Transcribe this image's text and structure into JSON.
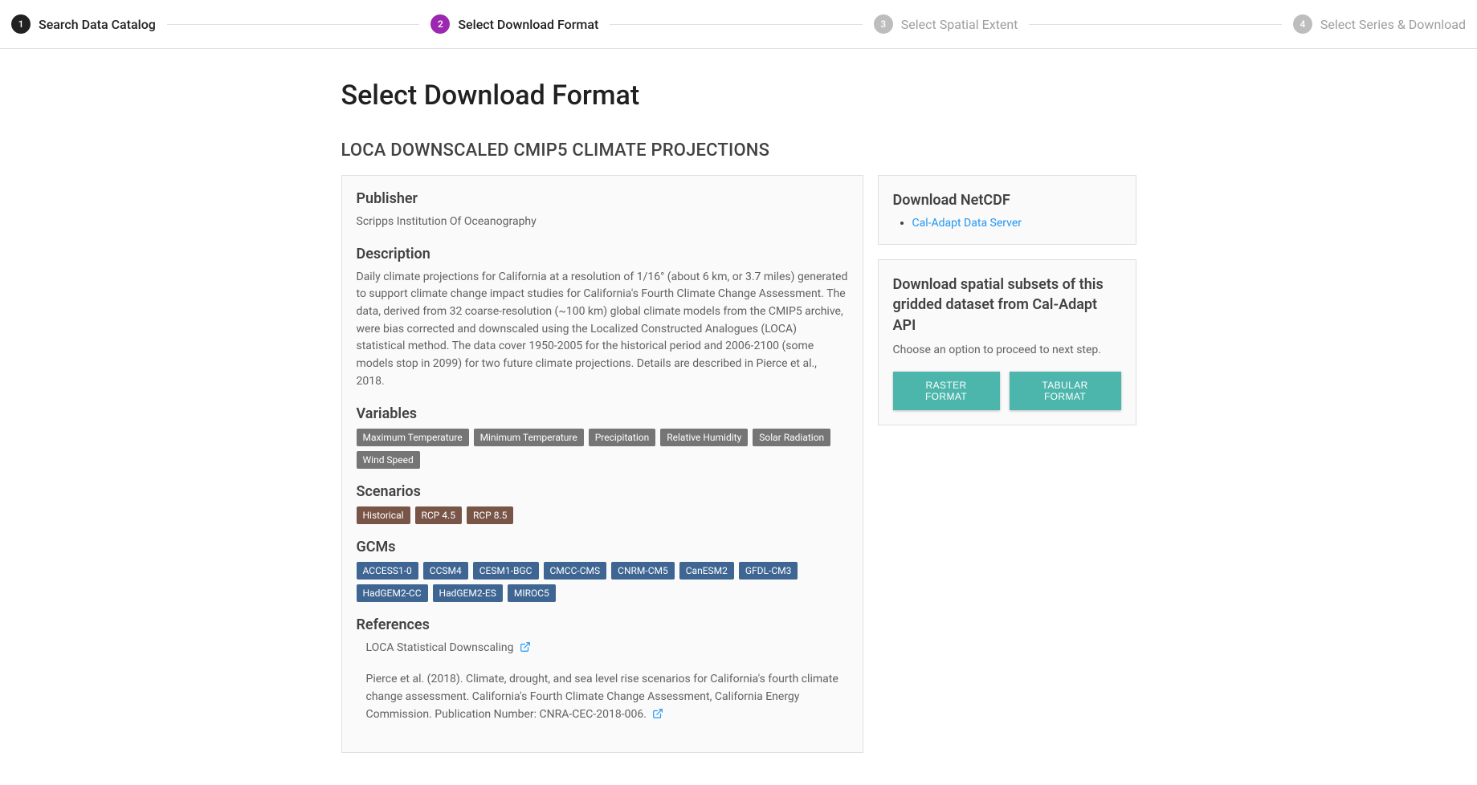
{
  "stepper": {
    "step1": {
      "num": "1",
      "label": "Search Data Catalog"
    },
    "step2": {
      "num": "2",
      "label": "Select Download Format"
    },
    "step3": {
      "num": "3",
      "label": "Select Spatial Extent"
    },
    "step4": {
      "num": "4",
      "label": "Select Series & Download"
    }
  },
  "page": {
    "title": "Select Download Format",
    "dataset_heading": "LOCA DOWNSCALED CMIP5 CLIMATE PROJECTIONS"
  },
  "main": {
    "publisher_heading": "Publisher",
    "publisher": "Scripps Institution Of Oceanography",
    "description_heading": "Description",
    "description": "Daily climate projections for California at a resolution of 1/16° (about 6 km, or 3.7 miles) generated to support climate change impact studies for California's Fourth Climate Change Assessment. The data, derived from 32 coarse-resolution (~100 km) global climate models from the CMIP5 archive, were bias corrected and downscaled using the Localized Constructed Analogues (LOCA) statistical method. The data cover 1950-2005 for the historical period and 2006-2100 (some models stop in 2099) for two future climate projections. Details are described in Pierce et al., 2018.",
    "variables_heading": "Variables",
    "variables": [
      "Maximum Temperature",
      "Minimum Temperature",
      "Precipitation",
      "Relative Humidity",
      "Solar Radiation",
      "Wind Speed"
    ],
    "scenarios_heading": "Scenarios",
    "scenarios": [
      "Historical",
      "RCP 4.5",
      "RCP 8.5"
    ],
    "gcms_heading": "GCMs",
    "gcms": [
      "ACCESS1-0",
      "CCSM4",
      "CESM1-BGC",
      "CMCC-CMS",
      "CNRM-CM5",
      "CanESM2",
      "GFDL-CM3",
      "HadGEM2-CC",
      "HadGEM2-ES",
      "MIROC5"
    ],
    "references_heading": "References",
    "ref1": "LOCA Statistical Downscaling",
    "ref2": "Pierce et al. (2018). Climate, drought, and sea level rise scenarios for California's fourth climate change assessment. California's Fourth Climate Change Assessment, California Energy Commission. Publication Number: CNRA-CEC-2018-006."
  },
  "side": {
    "netcdf_heading": "Download NetCDF",
    "netcdf_link": "Cal-Adapt Data Server",
    "subset_heading": "Download spatial subsets of this gridded dataset from Cal-Adapt API",
    "subset_hint": "Choose an option to proceed to next step.",
    "btn_raster": "RASTER FORMAT",
    "btn_tabular": "TABULAR FORMAT"
  }
}
